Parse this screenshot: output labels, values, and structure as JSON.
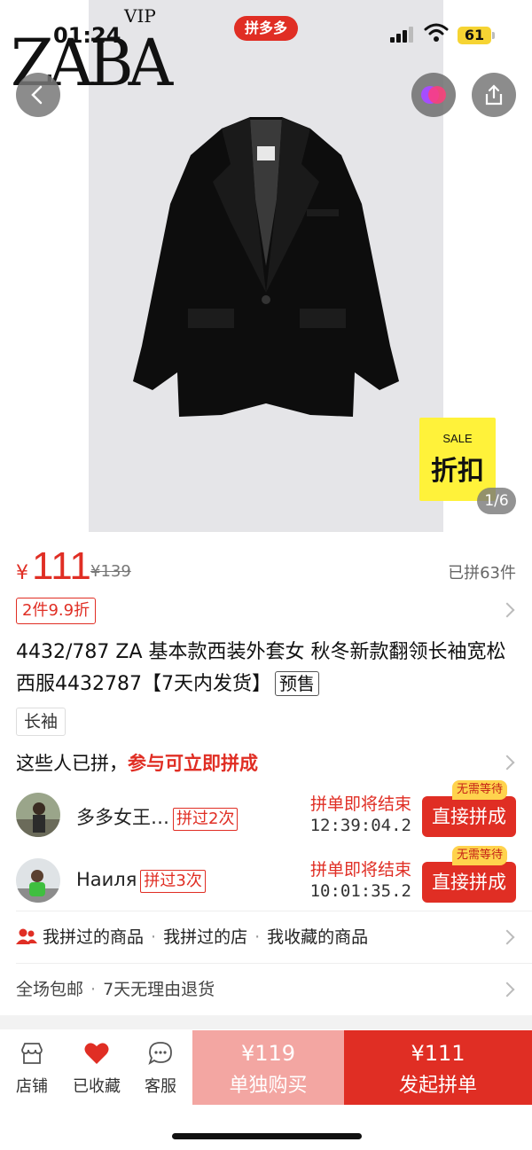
{
  "status_bar": {
    "time": "01:24",
    "app_name": "拼多多",
    "battery": "61"
  },
  "brand": {
    "logo": "ZABA",
    "vip": "VIP"
  },
  "gallery": {
    "sale_en": "SALE",
    "sale_cn": "折扣",
    "counter": "1/6"
  },
  "price": {
    "currency": "¥",
    "current": "111",
    "original": "¥139",
    "sold": "已拼63件",
    "promo": "2件9.9折"
  },
  "product": {
    "title": "4432/787 ZA 基本款西装外套女 秋冬新款翻领长袖宽松西服4432787【7天内发货】",
    "presale_tag": "预售",
    "attribute_tag": "长袖"
  },
  "group": {
    "head_prefix": "这些人已拼，",
    "head_highlight": "参与可立即拼成",
    "members": [
      {
        "name": "多多女王…",
        "count": "拼过2次",
        "status": "拼单即将结束",
        "timer": "12:39:04.2",
        "button": "直接拼成",
        "badge": "无需等待"
      },
      {
        "name": "Наиля",
        "count": "拼过3次",
        "status": "拼单即将结束",
        "timer": "10:01:35.2",
        "button": "直接拼成",
        "badge": "无需等待"
      }
    ]
  },
  "links": {
    "items": [
      "我拼过的商品",
      "我拼过的店",
      "我收藏的商品"
    ],
    "separator": "·"
  },
  "services": {
    "items": [
      "全场包邮",
      "7天无理由退货"
    ],
    "separator": "·"
  },
  "bottom_bar": {
    "store": "店铺",
    "favorited": "已收藏",
    "service": "客服",
    "buy_alone_price": "¥119",
    "buy_alone_label": "单独购买",
    "buy_group_price": "¥111",
    "buy_group_label": "发起拼单"
  },
  "colors": {
    "accent": "#e02e24",
    "alone_button": "#f3a6a2",
    "sale_yellow": "#fff23a"
  }
}
